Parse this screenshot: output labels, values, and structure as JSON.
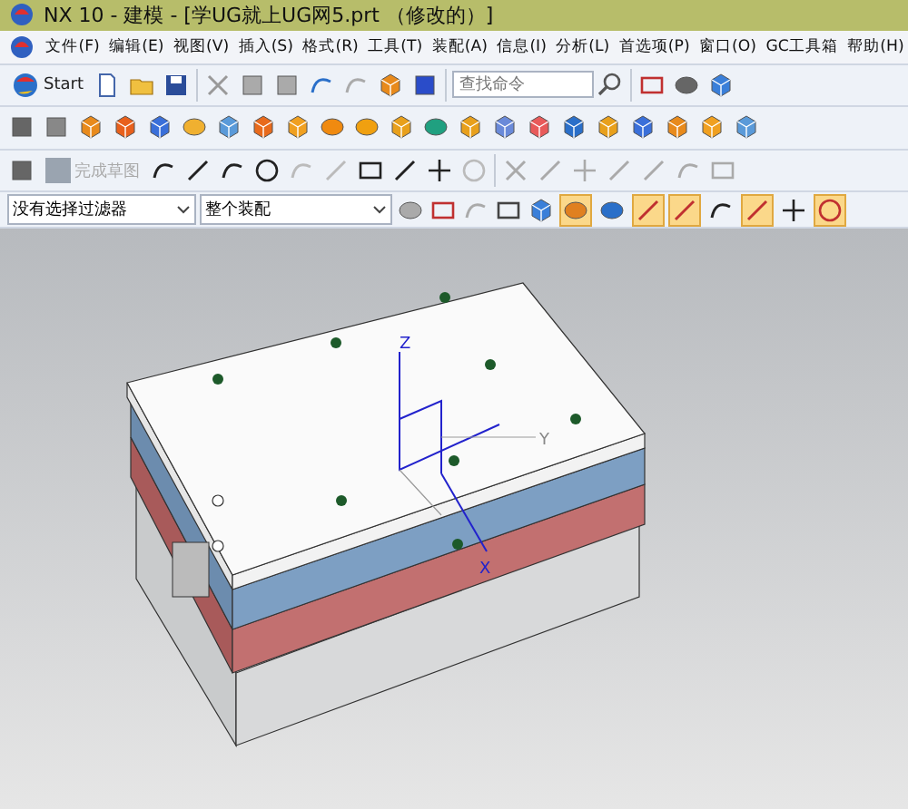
{
  "window": {
    "title": "NX 10 - 建模 - [学UG就上UG网5.prt （修改的）]"
  },
  "menu": [
    "文件(F)",
    "编辑(E)",
    "视图(V)",
    "插入(S)",
    "格式(R)",
    "工具(T)",
    "装配(A)",
    "信息(I)",
    "分析(L)",
    "首选项(P)",
    "窗口(O)",
    "GC工具箱",
    "帮助(H)"
  ],
  "standard_toolbar": {
    "start_label": "Start",
    "search": {
      "placeholder": "查找命令"
    }
  },
  "sketch_toolbar": {
    "finish_label": "完成草图",
    "finish_disabled": true
  },
  "selection_bar": {
    "filter": "没有选择过滤器",
    "scope": "整个装配",
    "snap_buttons": [
      {
        "on": true
      },
      {
        "on": false
      },
      {
        "on": true
      },
      {
        "on": true
      },
      {
        "on": false
      },
      {
        "on": true
      },
      {
        "on": false
      },
      {
        "on": true
      }
    ]
  },
  "viewport": {
    "axes": {
      "z": "Z",
      "y": "Y",
      "x": "X"
    }
  }
}
